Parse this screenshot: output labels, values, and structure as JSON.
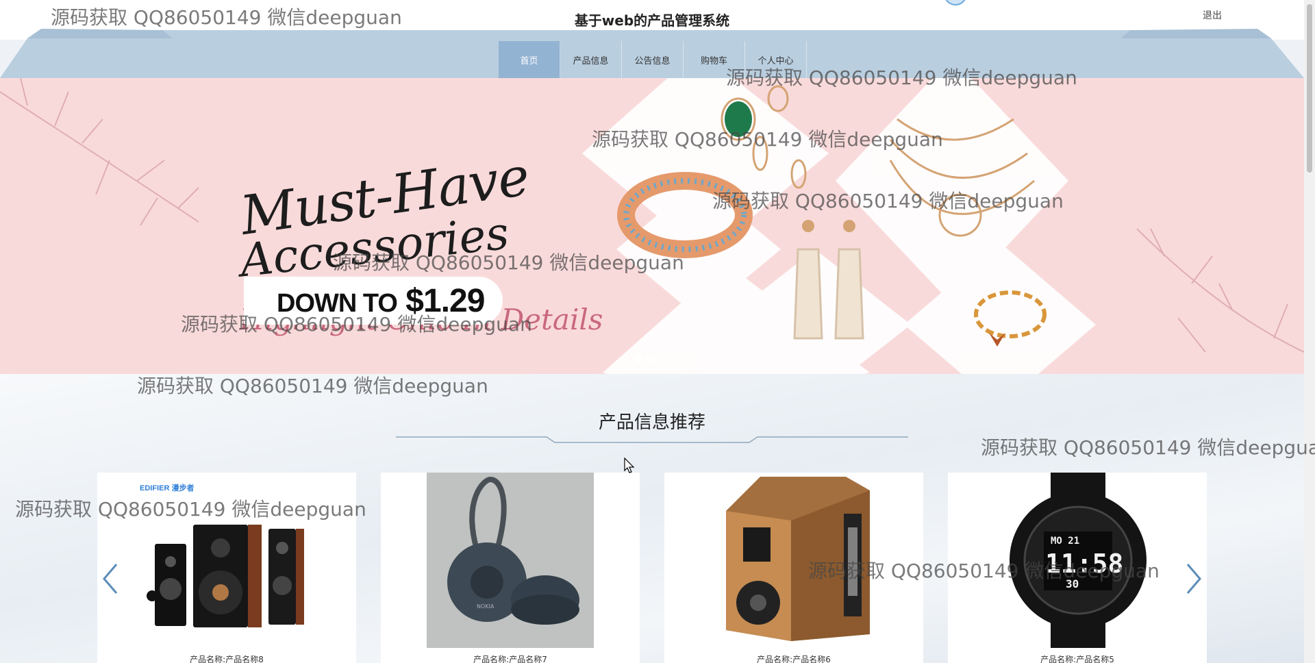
{
  "header": {
    "title": "基于web的产品管理系统",
    "logout_label": "退出"
  },
  "nav": {
    "items": [
      {
        "label": "首页",
        "active": true
      },
      {
        "label": "产品信息",
        "active": false
      },
      {
        "label": "公告信息",
        "active": false
      },
      {
        "label": "购物车",
        "active": false
      },
      {
        "label": "个人中心",
        "active": false
      }
    ]
  },
  "banner": {
    "headline_line1": "Must-Have",
    "headline_line2": "Accessories",
    "tagline": "Highlight Chic In Details",
    "price_prefix": "DOWN TO",
    "price_value": "$1.29",
    "slide_count": 3,
    "active_slide": 1
  },
  "recommend": {
    "title": "产品信息推荐",
    "products": [
      {
        "caption": "产品名称:产品名称8",
        "brand_text": "EDIFIER 漫步者",
        "icon": "speaker-set-image"
      },
      {
        "caption": "产品名称:产品名称7",
        "brand_text": "NOKIA",
        "icon": "portable-speaker-image"
      },
      {
        "caption": "产品名称:产品名称6",
        "brand_text": "",
        "icon": "wooden-speaker-image"
      },
      {
        "caption": "产品名称:产品名称5",
        "brand_text": "",
        "icon": "digital-watch-image",
        "watch_time": "11:58",
        "watch_top": "MO 21",
        "watch_bottom": "30"
      }
    ]
  },
  "watermark": {
    "text": "源码获取 QQ86050149 微信deepguan"
  },
  "colors": {
    "nav_band": "#b9cedf",
    "nav_active": "#93b3d3",
    "banner_bg": "#f9dada",
    "tagline": "#c9697d"
  }
}
